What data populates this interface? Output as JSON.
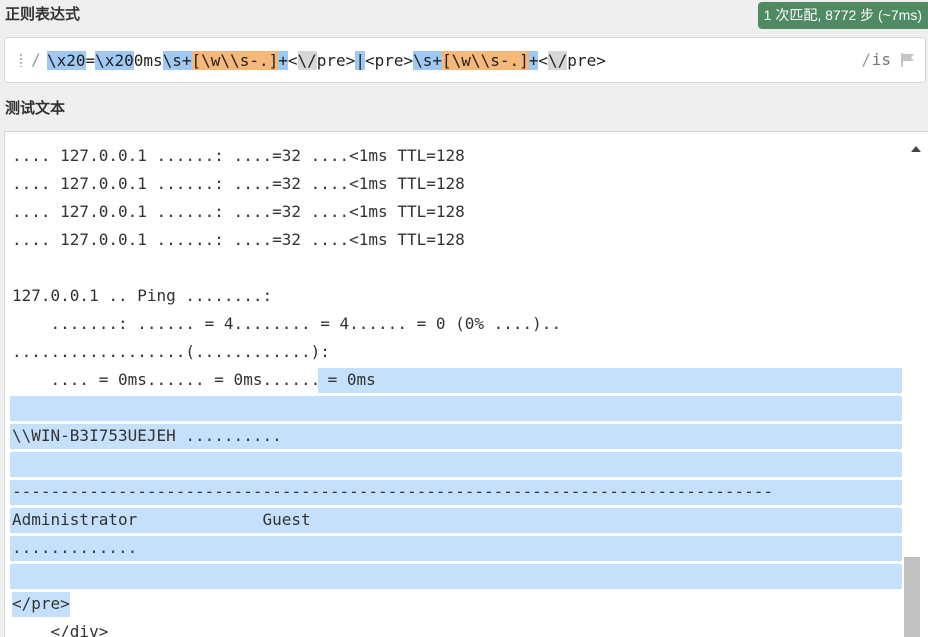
{
  "regex_section": {
    "title": "正则表达式",
    "match_status": "1 次匹配, 8772 步 (~7ms)",
    "open_delimiter": "/",
    "close_delimiter": "/",
    "flags": "is",
    "tokens": [
      {
        "text": "\\x20",
        "style": "blue"
      },
      {
        "text": "=",
        "style": "none"
      },
      {
        "text": "\\x20",
        "style": "blue"
      },
      {
        "text": "0ms",
        "style": "none"
      },
      {
        "text": "\\s+",
        "style": "blue"
      },
      {
        "text": "[",
        "style": "orange"
      },
      {
        "text": "\\w\\\\s-.",
        "style": "orange"
      },
      {
        "text": "]",
        "style": "orange"
      },
      {
        "text": "+",
        "style": "blue"
      },
      {
        "text": "<",
        "style": "none"
      },
      {
        "text": "\\/",
        "style": "gray"
      },
      {
        "text": "pre>",
        "style": "none"
      },
      {
        "text": "|",
        "style": "blue"
      },
      {
        "text": "<pre>",
        "style": "none"
      },
      {
        "text": "\\s+",
        "style": "blue"
      },
      {
        "text": "[",
        "style": "orange"
      },
      {
        "text": "\\w\\\\s-.",
        "style": "orange"
      },
      {
        "text": "]",
        "style": "orange"
      },
      {
        "text": "+",
        "style": "blue"
      },
      {
        "text": "<",
        "style": "none"
      },
      {
        "text": "\\/",
        "style": "gray"
      },
      {
        "text": "pre>",
        "style": "none"
      }
    ]
  },
  "test_section": {
    "title": "测试文本",
    "lines": [
      {
        "text": ".... 127.0.0.1 ......: ....=32 ....<1ms TTL=128",
        "hl": "none"
      },
      {
        "text": ".... 127.0.0.1 ......: ....=32 ....<1ms TTL=128",
        "hl": "none"
      },
      {
        "text": ".... 127.0.0.1 ......: ....=32 ....<1ms TTL=128",
        "hl": "none"
      },
      {
        "text": ".... 127.0.0.1 ......: ....=32 ....<1ms TTL=128",
        "hl": "none"
      },
      {
        "text": "",
        "hl": "none"
      },
      {
        "text": "127.0.0.1 .. Ping ........:",
        "hl": "none"
      },
      {
        "text": "    .......: ...... = 4........ = 4...... = 0 (0% ....)..",
        "hl": "none"
      },
      {
        "text": "..................(............):",
        "hl": "none"
      },
      {
        "text": "    .... = 0ms...... = 0ms......",
        "hl_tail": " = 0ms",
        "hl": "partial"
      },
      {
        "text": "",
        "hl": "full"
      },
      {
        "text": "\\\\WIN-B3I753UEJEH ..........",
        "hl": "full"
      },
      {
        "text": "",
        "hl": "full"
      },
      {
        "text": "-------------------------------------------------------------------------------",
        "hl": "full"
      },
      {
        "text": "Administrator             Guest",
        "hl": "full"
      },
      {
        "text": ".............",
        "hl": "full"
      },
      {
        "text": "",
        "hl": "full"
      },
      {
        "text": "</pre>",
        "hl": "end"
      },
      {
        "text": "    </div>",
        "hl": "none"
      }
    ]
  },
  "icons": [
    "grip-icon",
    "flag-icon",
    "scroll-up-arrow-icon"
  ]
}
